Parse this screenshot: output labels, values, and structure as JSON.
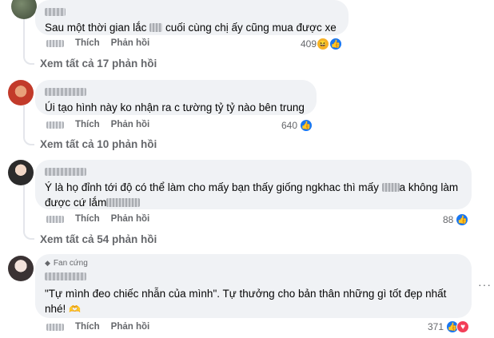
{
  "comments": [
    {
      "text": "Sau một thời gian lắc",
      "text_after": "cuối cùng chị ấy cũng mua được xe",
      "like_label": "Thích",
      "reply_label": "Phản hồi",
      "reaction_count": "409",
      "reactions": [
        "haha",
        "like"
      ],
      "see_replies": "Xem tất cả 17 phản hồi"
    },
    {
      "text": "Úi tạo hình này ko nhận ra c tường tỷ tỷ nào bên trung",
      "like_label": "Thích",
      "reply_label": "Phản hồi",
      "reaction_count": "640",
      "reactions": [
        "like"
      ],
      "see_replies": "Xem tất cả 10 phản hồi"
    },
    {
      "text_line1": "Ý là họ đỉnh tới độ có thể làm cho mấy bạn thấy giống ngkhac thì mấy",
      "text_line1_after": "a không làm",
      "text_line2": "được cứ lắm",
      "like_label": "Thích",
      "reply_label": "Phản hồi",
      "reaction_count": "88",
      "reactions": [
        "like"
      ],
      "see_replies": "Xem tất cả 54 phản hồi"
    },
    {
      "badge": "Fan cứng",
      "text_line1": "\"Tự mình đeo chiếc nhẫn của mình\". Tự thưởng cho bản thân những gì tốt đẹp nhất",
      "text_line2": "nhé!",
      "like_label": "Thích",
      "reply_label": "Phản hồi",
      "reaction_count": "371",
      "reactions": [
        "like",
        "love"
      ]
    }
  ],
  "colors": {
    "bubble": "#f0f2f5",
    "secondary_text": "#65676b",
    "like": "#1877f2",
    "love": "#f33e58",
    "haha": "#f7b125"
  },
  "icons": {
    "more": "more-horizontal-icon",
    "badge": "diamond-icon"
  }
}
